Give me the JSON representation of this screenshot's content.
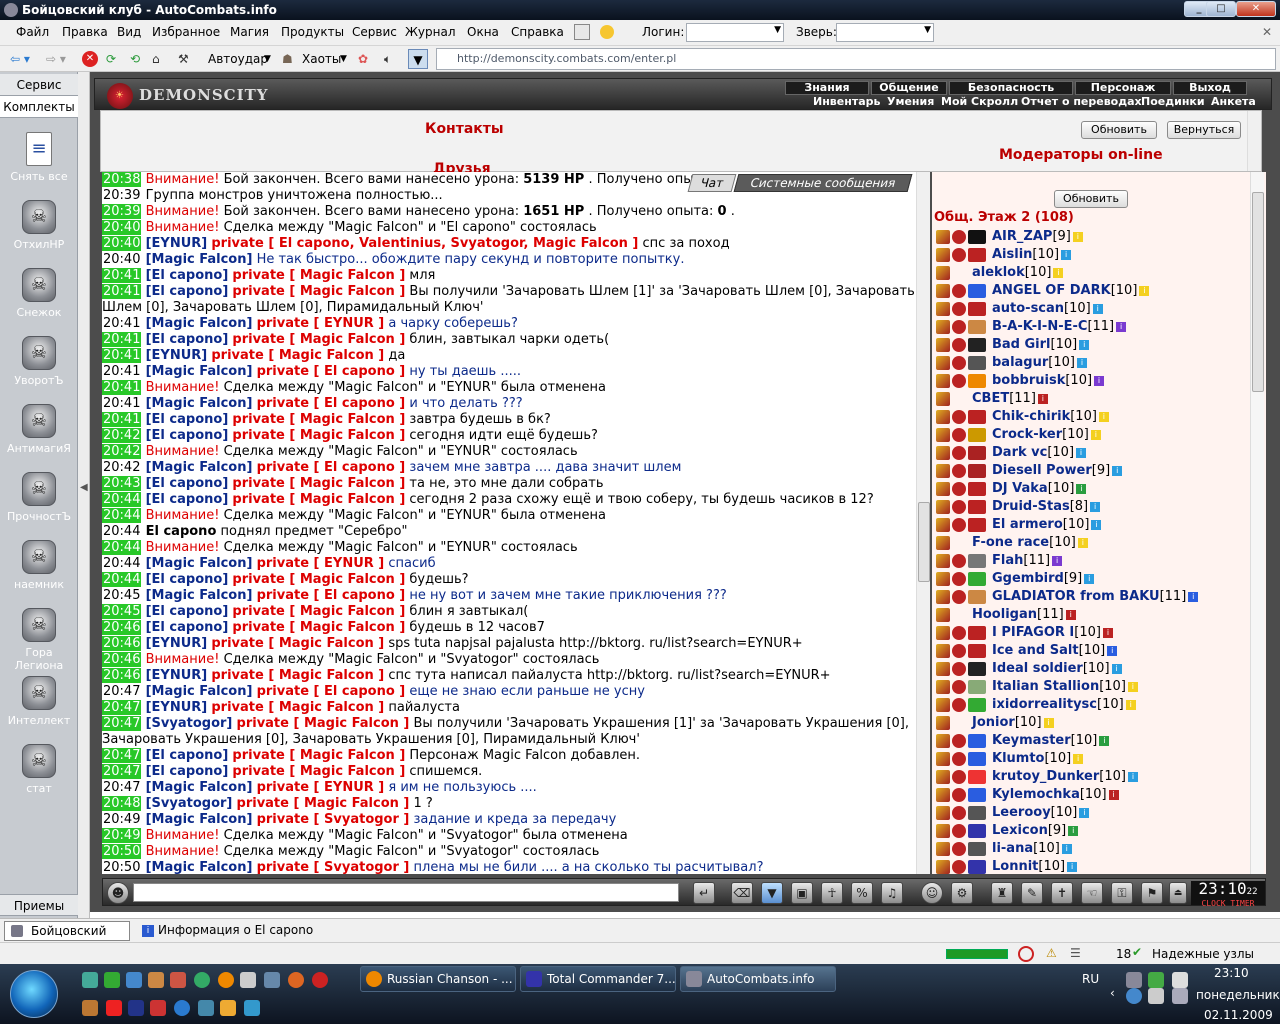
{
  "window": {
    "title": "Бойцовский клуб - AutoCombats.info",
    "min": "_",
    "max": "□",
    "close": "✕"
  },
  "menu": {
    "items": [
      "Файл",
      "Правка",
      "Вид",
      "Избранное",
      "Магия",
      "Продукты",
      "Сервис",
      "Журнал",
      "Окна",
      "Справка"
    ],
    "login_label": "Логин:",
    "pet_label": "Зверь:",
    "x": "✕"
  },
  "toolbar": {
    "autoudar": "Автоудар",
    "haoty": "Хаоты",
    "url": "http://demonscity.combats.com/enter.pl"
  },
  "left": {
    "tab1": "Сервис",
    "tab2": "Комплекты",
    "bottom": "Приемы",
    "items": [
      "Снять все",
      "ОтхилHP",
      "Снежок",
      "УворотЪ",
      "АнтимагиЯ",
      "ПрочностЪ",
      "наемник",
      "Гора Легиона",
      "Интеллект",
      "стат"
    ]
  },
  "game": {
    "logo": "DEMONSCITY",
    "nav_top": [
      "Знания",
      "Общение",
      "Безопасность",
      "Персонаж",
      "Выход"
    ],
    "nav_bot": [
      "Инвентарь",
      "Умения",
      "Мой Скролл",
      "Отчет о переводах",
      "Поединки",
      "Анкета"
    ],
    "contacts": "Контакты",
    "friends": "Друзья",
    "moderators": "Модераторы on-line",
    "refresh": "Обновить",
    "back": "Вернуться",
    "tab_chat": "Чат",
    "tab_sys": "Системные сообщения",
    "list_refresh": "Обновить",
    "list_title": "Общ. Этаж 2 (108)",
    "clock": "23:10",
    "clock_sec": "22",
    "clock_lbl": "CLOCK TIMER"
  },
  "chat": [
    {
      "t": "20:38",
      "g": true,
      "parts": [
        [
          "tw",
          "Внимание!"
        ],
        [
          "",
          "Бой закончен. Всего вами нанесено урона: "
        ],
        [
          "bo",
          "5139 HP"
        ],
        [
          "",
          ". Получено опы"
        ]
      ]
    },
    {
      "t": "20:39",
      "g": false,
      "parts": [
        [
          "",
          "Группа монстров уничтожена полностью..."
        ]
      ]
    },
    {
      "t": "20:39",
      "g": true,
      "parts": [
        [
          "tw",
          "Внимание!"
        ],
        [
          "",
          "Бой закончен. Всего вами нанесено урона: "
        ],
        [
          "bo",
          "1651 HP"
        ],
        [
          "",
          ". Получено опыта: "
        ],
        [
          "bo",
          "0"
        ],
        [
          "",
          "."
        ]
      ]
    },
    {
      "t": "20:40",
      "g": true,
      "parts": [
        [
          "tw",
          "Внимание!"
        ],
        [
          "",
          "Сделка между \"Magic Falcon\" и \"El capono\" состоялась"
        ]
      ]
    },
    {
      "t": "20:40",
      "g": true,
      "parts": [
        [
          "nm",
          "[EYNUR]"
        ],
        [
          "pv",
          "private [ El capono, Valentinius, Svyatogor, Magic Falcon ]"
        ],
        [
          "",
          "спс за поход"
        ]
      ]
    },
    {
      "t": "20:40",
      "g": false,
      "parts": [
        [
          "nm",
          "[Magic Falcon]"
        ],
        [
          "msg",
          "Не так быстро... обождите пару секунд и повторите попытку."
        ]
      ]
    },
    {
      "t": "20:41",
      "g": true,
      "parts": [
        [
          "nm",
          "[El capono]"
        ],
        [
          "pv",
          "private [ Magic Falcon ]"
        ],
        [
          "",
          "мля"
        ]
      ]
    },
    {
      "t": "20:41",
      "g": true,
      "wrap": true,
      "parts": [
        [
          "nm",
          "[El capono]"
        ],
        [
          "pv",
          "private [ Magic Falcon ]"
        ],
        [
          "",
          "Вы получили 'Зачаровать Шлем [1]' за 'Зачаровать Шлем [0], Зачаровать Шлем [0], Зачаровать Шлем [0], Пирамидальный Ключ'"
        ]
      ]
    },
    {
      "t": "20:41",
      "g": false,
      "parts": [
        [
          "nm",
          "[Magic Falcon]"
        ],
        [
          "pv",
          "private [ EYNUR ]"
        ],
        [
          "msg",
          "а чарку соберешь?"
        ]
      ]
    },
    {
      "t": "20:41",
      "g": true,
      "parts": [
        [
          "nm",
          "[El capono]"
        ],
        [
          "pv",
          "private [ Magic Falcon ]"
        ],
        [
          "",
          "блин, завтыкал чарки одеть("
        ]
      ]
    },
    {
      "t": "20:41",
      "g": true,
      "parts": [
        [
          "nm",
          "[EYNUR]"
        ],
        [
          "pv",
          "private [ Magic Falcon ]"
        ],
        [
          "",
          "да"
        ]
      ]
    },
    {
      "t": "20:41",
      "g": false,
      "parts": [
        [
          "nm",
          "[Magic Falcon]"
        ],
        [
          "pv",
          "private [ El capono ]"
        ],
        [
          "msg",
          "ну ты даешь ....."
        ]
      ]
    },
    {
      "t": "20:41",
      "g": true,
      "parts": [
        [
          "tw",
          "Внимание!"
        ],
        [
          "",
          "Сделка между \"Magic Falcon\" и \"EYNUR\" была отменена"
        ]
      ]
    },
    {
      "t": "20:41",
      "g": false,
      "parts": [
        [
          "nm",
          "[Magic Falcon]"
        ],
        [
          "pv",
          "private [ El capono ]"
        ],
        [
          "msg",
          "и что делать ???"
        ]
      ]
    },
    {
      "t": "20:41",
      "g": true,
      "parts": [
        [
          "nm",
          "[El capono]"
        ],
        [
          "pv",
          "private [ Magic Falcon ]"
        ],
        [
          "",
          "завтра будешь в бк?"
        ]
      ]
    },
    {
      "t": "20:42",
      "g": true,
      "parts": [
        [
          "nm",
          "[El capono]"
        ],
        [
          "pv",
          "private [ Magic Falcon ]"
        ],
        [
          "",
          "сегодня идти ещё будешь?"
        ]
      ]
    },
    {
      "t": "20:42",
      "g": true,
      "parts": [
        [
          "tw",
          "Внимание!"
        ],
        [
          "",
          "Сделка между \"Magic Falcon\" и \"EYNUR\" состоялась"
        ]
      ]
    },
    {
      "t": "20:42",
      "g": false,
      "parts": [
        [
          "nm",
          "[Magic Falcon]"
        ],
        [
          "pv",
          "private [ El capono ]"
        ],
        [
          "msg",
          "зачем мне завтра .... дава значит шлем"
        ]
      ]
    },
    {
      "t": "20:43",
      "g": true,
      "parts": [
        [
          "nm",
          "[El capono]"
        ],
        [
          "pv",
          "private [ Magic Falcon ]"
        ],
        [
          "",
          "та не, это мне дали собрать"
        ]
      ]
    },
    {
      "t": "20:44",
      "g": true,
      "parts": [
        [
          "nm",
          "[El capono]"
        ],
        [
          "pv",
          "private [ Magic Falcon ]"
        ],
        [
          "",
          "сегодня 2 раза схожу ещё и твою соберу, ты будешь часиков в 12?"
        ]
      ]
    },
    {
      "t": "20:44",
      "g": true,
      "parts": [
        [
          "tw",
          "Внимание!"
        ],
        [
          "",
          "Сделка между \"Magic Falcon\" и \"EYNUR\" была отменена"
        ]
      ]
    },
    {
      "t": "20:44",
      "g": false,
      "parts": [
        [
          "bo",
          "El capono"
        ],
        [
          "",
          "поднял предмет \"Серебро\""
        ]
      ]
    },
    {
      "t": "20:44",
      "g": true,
      "parts": [
        [
          "tw",
          "Внимание!"
        ],
        [
          "",
          "Сделка между \"Magic Falcon\" и \"EYNUR\" состоялась"
        ]
      ]
    },
    {
      "t": "20:44",
      "g": false,
      "parts": [
        [
          "nm",
          "[Magic Falcon]"
        ],
        [
          "pv",
          "private [ EYNUR ]"
        ],
        [
          "msg",
          "спасиб"
        ]
      ]
    },
    {
      "t": "20:44",
      "g": true,
      "parts": [
        [
          "nm",
          "[El capono]"
        ],
        [
          "pv",
          "private [ Magic Falcon ]"
        ],
        [
          "",
          "будешь?"
        ]
      ]
    },
    {
      "t": "20:45",
      "g": false,
      "parts": [
        [
          "nm",
          "[Magic Falcon]"
        ],
        [
          "pv",
          "private [ El capono ]"
        ],
        [
          "msg",
          "не ну вот и зачем мне такие приключения ???"
        ]
      ]
    },
    {
      "t": "20:45",
      "g": true,
      "parts": [
        [
          "nm",
          "[El capono]"
        ],
        [
          "pv",
          "private [ Magic Falcon ]"
        ],
        [
          "",
          "блин я завтыкал("
        ]
      ]
    },
    {
      "t": "20:46",
      "g": true,
      "parts": [
        [
          "nm",
          "[El capono]"
        ],
        [
          "pv",
          "private [ Magic Falcon ]"
        ],
        [
          "",
          "будешь в 12 часов7"
        ]
      ]
    },
    {
      "t": "20:46",
      "g": true,
      "parts": [
        [
          "nm",
          "[EYNUR]"
        ],
        [
          "pv",
          "private [ Magic Falcon ]"
        ],
        [
          "",
          "sps tuta napjsal pajalusta http://bktorg. ru/list?search=EYNUR+"
        ]
      ]
    },
    {
      "t": "20:46",
      "g": true,
      "parts": [
        [
          "tw",
          "Внимание!"
        ],
        [
          "",
          "Сделка между \"Magic Falcon\" и \"Svyatogor\" состоялась"
        ]
      ]
    },
    {
      "t": "20:46",
      "g": true,
      "parts": [
        [
          "nm",
          "[EYNUR]"
        ],
        [
          "pv",
          "private [ Magic Falcon ]"
        ],
        [
          "",
          "спс тута написал пайалуста http://bktorg. ru/list?search=EYNUR+"
        ]
      ]
    },
    {
      "t": "20:47",
      "g": false,
      "parts": [
        [
          "nm",
          "[Magic Falcon]"
        ],
        [
          "pv",
          "private [ El capono ]"
        ],
        [
          "msg",
          "еще не знаю если раньше не усну"
        ]
      ]
    },
    {
      "t": "20:47",
      "g": true,
      "parts": [
        [
          "nm",
          "[EYNUR]"
        ],
        [
          "pv",
          "private [ Magic Falcon ]"
        ],
        [
          "",
          "пайалуста"
        ]
      ]
    },
    {
      "t": "20:47",
      "g": true,
      "wrap": true,
      "parts": [
        [
          "nm",
          "[Svyatogor]"
        ],
        [
          "pv",
          "private [ Magic Falcon ]"
        ],
        [
          "",
          "Вы получили 'Зачаровать Украшения [1]' за 'Зачаровать Украшения [0], Зачаровать Украшения [0], Зачаровать Украшения [0], Пирамидальный Ключ'"
        ]
      ]
    },
    {
      "t": "20:47",
      "g": true,
      "parts": [
        [
          "nm",
          "[El capono]"
        ],
        [
          "pv",
          "private [ Magic Falcon ]"
        ],
        [
          "",
          "Персонаж Magic Falcon добавлен."
        ]
      ]
    },
    {
      "t": "20:47",
      "g": true,
      "parts": [
        [
          "nm",
          "[El capono]"
        ],
        [
          "pv",
          "private [ Magic Falcon ]"
        ],
        [
          "",
          "спишемся."
        ]
      ]
    },
    {
      "t": "20:47",
      "g": false,
      "parts": [
        [
          "nm",
          "[Magic Falcon]"
        ],
        [
          "pv",
          "private [ EYNUR ]"
        ],
        [
          "msg",
          "я им не пользуюсь ...."
        ]
      ]
    },
    {
      "t": "20:48",
      "g": true,
      "parts": [
        [
          "nm",
          "[Svyatogor]"
        ],
        [
          "pv",
          "private [ Magic Falcon ]"
        ],
        [
          "",
          "1 ?"
        ]
      ]
    },
    {
      "t": "20:49",
      "g": false,
      "parts": [
        [
          "nm",
          "[Magic Falcon]"
        ],
        [
          "pv",
          "private [ Svyatogor ]"
        ],
        [
          "msg",
          "задание и креда за передачу"
        ]
      ]
    },
    {
      "t": "20:49",
      "g": true,
      "parts": [
        [
          "tw",
          "Внимание!"
        ],
        [
          "",
          "Сделка между \"Magic Falcon\" и \"Svyatogor\" была отменена"
        ]
      ]
    },
    {
      "t": "20:50",
      "g": true,
      "parts": [
        [
          "tw",
          "Внимание!"
        ],
        [
          "",
          "Сделка между \"Magic Falcon\" и \"Svyatogor\" состоялась"
        ]
      ]
    },
    {
      "t": "20:50",
      "g": false,
      "parts": [
        [
          "nm",
          "[Magic Falcon]"
        ],
        [
          "pv",
          "private [ Svyatogor ]"
        ],
        [
          "msg",
          "плена мы не били .... а на сколько ты расчитывал?"
        ]
      ]
    }
  ],
  "players": [
    {
      "n": "AIR_ZAP",
      "l": "[9]",
      "c": "#f4d020",
      "ic": "#111",
      "indent": 1
    },
    {
      "n": "Aislin",
      "l": "[10]",
      "c": "#2a9de0",
      "ic": "#b22",
      "indent": 1
    },
    {
      "n": "aleklok",
      "l": "[10]",
      "c": "#f4d020",
      "ic": "",
      "indent": 0
    },
    {
      "n": "ANGEL OF DARK",
      "l": "[10]",
      "c": "#f4d020",
      "ic": "#2a5de0",
      "indent": 1
    },
    {
      "n": "auto-scan",
      "l": "[10]",
      "c": "#2a9de0",
      "ic": "#b22",
      "indent": 1
    },
    {
      "n": "B-A-K-I-N-E-C",
      "l": "[11]",
      "c": "#7a3ad0",
      "ic": "#c84",
      "indent": 1
    },
    {
      "n": "Bad Girl",
      "l": "[10]",
      "c": "#2a9de0",
      "ic": "#222",
      "indent": 1
    },
    {
      "n": "balagur",
      "l": "[10]",
      "c": "#2a9de0",
      "ic": "#555",
      "indent": 1
    },
    {
      "n": "bobbruisk",
      "l": "[10]",
      "c": "#7a3ad0",
      "ic": "#e80",
      "indent": 1
    },
    {
      "n": "CBET",
      "l": "[11]",
      "c": "#b22",
      "ic": "",
      "indent": 0
    },
    {
      "n": "Chik-chirik",
      "l": "[10]",
      "c": "#f4d020",
      "ic": "#b22",
      "indent": 1
    },
    {
      "n": "Crock-ker",
      "l": "[10]",
      "c": "#f4d020",
      "ic": "#c90",
      "indent": 1
    },
    {
      "n": "Dark vc",
      "l": "[10]",
      "c": "#2a9de0",
      "ic": "#a22",
      "indent": 1
    },
    {
      "n": "Diesell Power",
      "l": "[9]",
      "c": "#2a9de0",
      "ic": "#a22",
      "indent": 1
    },
    {
      "n": "DJ Vaka",
      "l": "[10]",
      "c": "#2a9d40",
      "ic": "#b22",
      "indent": 1
    },
    {
      "n": "Druid-Stas",
      "l": "[8]",
      "c": "#2a9de0",
      "ic": "#b22",
      "indent": 1
    },
    {
      "n": "El armero",
      "l": "[10]",
      "c": "#2a9de0",
      "ic": "#b22",
      "indent": 1
    },
    {
      "n": "F-one race",
      "l": "[10]",
      "c": "#f4d020",
      "ic": "",
      "indent": 0
    },
    {
      "n": "Flah",
      "l": "[11]",
      "c": "#7a3ad0",
      "ic": "#777",
      "indent": 1
    },
    {
      "n": "Ggembird",
      "l": "[9]",
      "c": "#2a9de0",
      "ic": "#3a3",
      "indent": 1
    },
    {
      "n": "GLADIATOR from BAKU",
      "l": "[11]",
      "c": "#2a5de0",
      "ic": "#c84",
      "indent": 1
    },
    {
      "n": "Hooligan",
      "l": "[11]",
      "c": "#b22",
      "ic": "",
      "indent": 0
    },
    {
      "n": "I PIFAGOR I",
      "l": "[10]",
      "c": "#b22",
      "ic": "#b22",
      "indent": 1
    },
    {
      "n": "Ice and Salt",
      "l": "[10]",
      "c": "#2a5de0",
      "ic": "#b22",
      "indent": 1
    },
    {
      "n": "Ideal soldier",
      "l": "[10]",
      "c": "#2a9de0",
      "ic": "#222",
      "indent": 1
    },
    {
      "n": "Italian Stallion",
      "l": "[10]",
      "c": "#f4d020",
      "ic": "#8a7",
      "indent": 1
    },
    {
      "n": "ixidorrealitysc",
      "l": "[10]",
      "c": "#f4d020",
      "ic": "#3a3",
      "indent": 1
    },
    {
      "n": "Jonior",
      "l": "[10]",
      "c": "#f4d020",
      "ic": "",
      "indent": 0
    },
    {
      "n": "Keymaster",
      "l": "[10]",
      "c": "#2a9d40",
      "ic": "#2a5de0",
      "indent": 1
    },
    {
      "n": "Klumto",
      "l": "[10]",
      "c": "#f4d020",
      "ic": "#2a5de0",
      "indent": 1
    },
    {
      "n": "krutoy_Dunker",
      "l": "[10]",
      "c": "#2a9de0",
      "ic": "#e33",
      "indent": 1
    },
    {
      "n": "Kylemochka",
      "l": "[10]",
      "c": "#b22",
      "ic": "#2a5de0",
      "indent": 1
    },
    {
      "n": "Leerooy",
      "l": "[10]",
      "c": "#2a9de0",
      "ic": "#555",
      "indent": 1
    },
    {
      "n": "Lexicon",
      "l": "[9]",
      "c": "#2a9d40",
      "ic": "#33a",
      "indent": 1
    },
    {
      "n": "li-ana",
      "l": "[10]",
      "c": "#2a9de0",
      "ic": "#555",
      "indent": 1
    },
    {
      "n": "Lonnit",
      "l": "[10]",
      "c": "#2a9de0",
      "ic": "#33a",
      "indent": 1
    }
  ],
  "tabsbar": {
    "t1": "Бойцовский клуб",
    "t2": "Информация о El capono"
  },
  "status": {
    "count": "18",
    "reliable": "Надежные узлы",
    "lang": "RU",
    "time": "23:10",
    "day": "понедельник",
    "date": "02.11.2009"
  },
  "taskbar": {
    "b1": "Russian Chanson - ...",
    "b2": "Total Commander 7....",
    "b3": "AutoCombats.info"
  }
}
